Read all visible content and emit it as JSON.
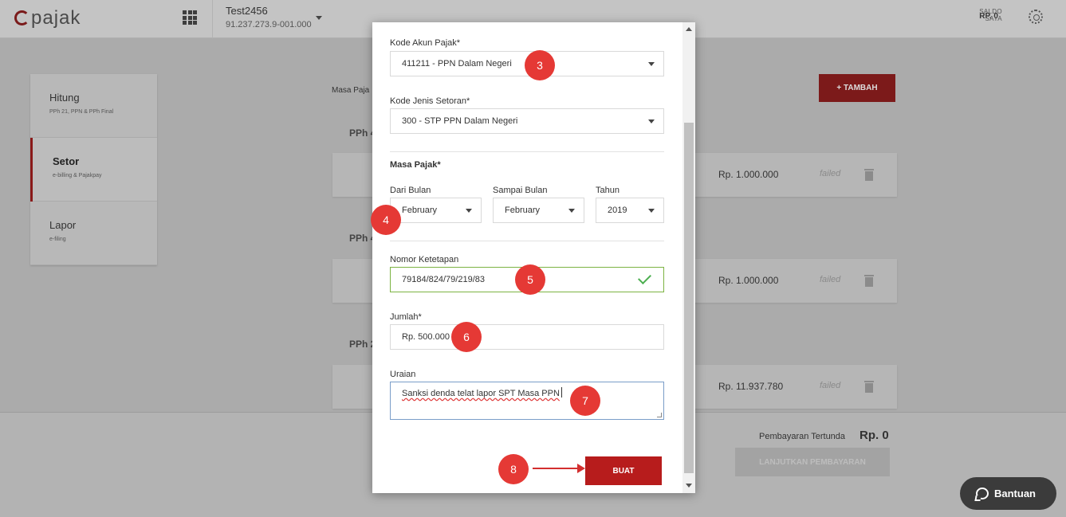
{
  "header": {
    "logo": "pajak",
    "company_name": "Test2456",
    "npwp": "91.237.273.9-001.000",
    "saldo_label": "SALDO SAYA",
    "saldo_value": "RP. 0"
  },
  "sidebar": {
    "items": [
      {
        "label": "Hitung",
        "sub": "PPh 21, PPN & PPh Final"
      },
      {
        "label": "Setor",
        "sub": "e-billing & Pajakpay"
      },
      {
        "label": "Lapor",
        "sub": "e-filing"
      }
    ]
  },
  "main": {
    "masa_label": "Masa Paja",
    "tambah_label": "+ TAMBAH",
    "sections": [
      "PPh 4",
      "PPh 4",
      "PPh 2"
    ],
    "rows": [
      {
        "amount": "Rp. 1.000.000",
        "status": "failed"
      },
      {
        "amount": "Rp. 1.000.000",
        "status": "failed"
      },
      {
        "amount": "Rp. 11.937.780",
        "status": "failed"
      }
    ]
  },
  "footer": {
    "pending_label": "Pembayaran Tertunda",
    "pending_value": "Rp. 0",
    "continue_label": "LANJUTKAN PEMBAYARAN",
    "help_label": "Bantuan"
  },
  "modal": {
    "kode_akun_label": "Kode Akun Pajak*",
    "kode_akun_value": "411211 - PPN Dalam Negeri",
    "kode_jenis_label": "Kode Jenis Setoran*",
    "kode_jenis_value": "300 - STP PPN Dalam Negeri",
    "masa_pajak_label": "Masa Pajak*",
    "dari_bulan_label": "Dari Bulan",
    "dari_bulan_value": "February",
    "sampai_bulan_label": "Sampai Bulan",
    "sampai_bulan_value": "February",
    "tahun_label": "Tahun",
    "tahun_value": "2019",
    "nomor_label": "Nomor Ketetapan",
    "nomor_value": "79184/824/79/219/83",
    "jumlah_label": "Jumlah*",
    "jumlah_value": "Rp. 500.000",
    "uraian_label": "Uraian",
    "uraian_value": "Sanksi denda telat lapor SPT Masa PPN",
    "buat_label": "BUAT"
  },
  "markers": [
    "3",
    "4",
    "5",
    "6",
    "7",
    "8"
  ],
  "colors": {
    "brand": "#b71c1c",
    "valid": "#7cb342",
    "marker": "#e53935"
  }
}
